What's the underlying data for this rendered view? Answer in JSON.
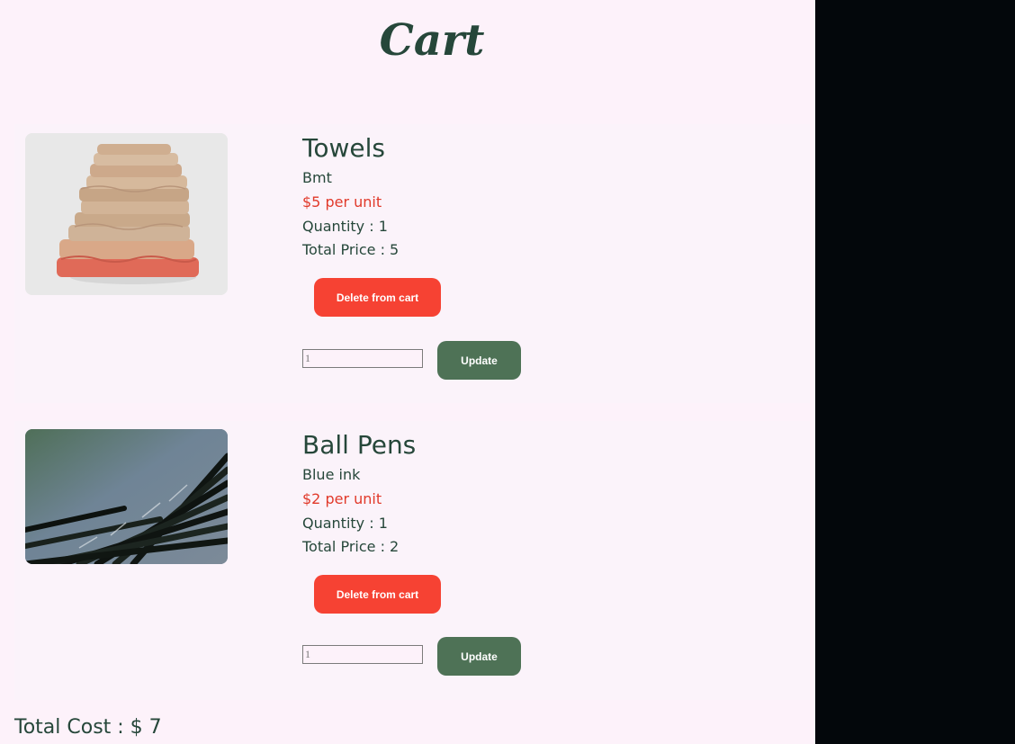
{
  "page": {
    "title": "Cart"
  },
  "items": [
    {
      "name": "Towels",
      "description": "Bmt",
      "price": "$5 per unit",
      "quantity": "Quantity : 1",
      "total_price": "Total Price : 5",
      "delete_label": "Delete from cart",
      "qty_placeholder": "1",
      "update_label": "Update",
      "image_icon": "towels-image"
    },
    {
      "name": "Ball Pens",
      "description": "Blue ink",
      "price": "$2 per unit",
      "quantity": "Quantity : 1",
      "total_price": "Total Price : 2",
      "delete_label": "Delete from cart",
      "qty_placeholder": "1",
      "update_label": "Update",
      "image_icon": "ball-pens-image"
    }
  ],
  "summary": {
    "total_cost": "Total Cost : $ 7"
  },
  "colors": {
    "page_bg": "#fdf2fa",
    "side_bg": "#03070b",
    "text": "#26473a",
    "price": "#e1392a",
    "delete_button": "#f64233",
    "update_button": "#4e7256"
  }
}
